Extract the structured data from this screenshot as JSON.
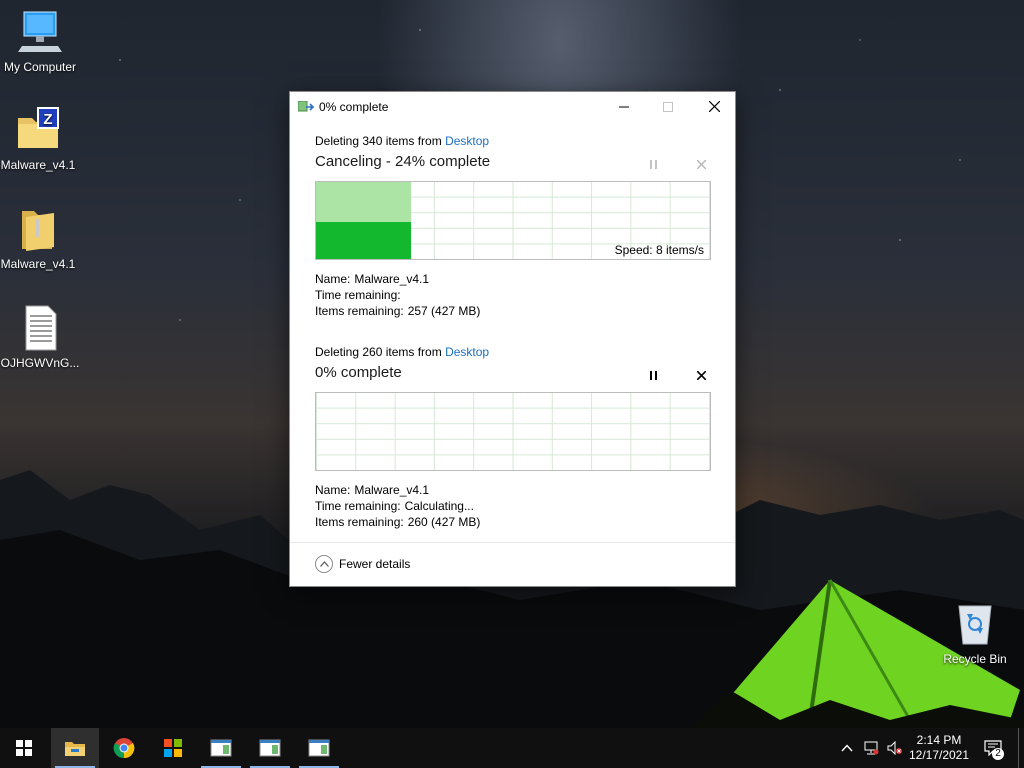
{
  "desktop": {
    "icons": [
      {
        "label": "My Computer",
        "icon": "computer-icon"
      },
      {
        "label": "Malware_v4.1",
        "icon": "zip-folder-icon"
      },
      {
        "label": "Malware_v4.1",
        "icon": "folder-icon"
      },
      {
        "label": "OJHGWVnG...",
        "icon": "text-file-icon"
      },
      {
        "label": "Recycle Bin",
        "icon": "recycle-bin-icon"
      }
    ]
  },
  "dialog": {
    "title": "0% complete",
    "op1": {
      "from_prefix": "Deleting 340 items from",
      "from_link": "Desktop",
      "status": "Canceling - 24% complete",
      "progress_fraction": 0.24,
      "speed": "Speed: 8 items/s",
      "name_label": "Name:",
      "name_value": "Malware_v4.1",
      "time_label": "Time remaining:",
      "time_value": "",
      "items_label": "Items remaining:",
      "items_value": "257 (427 MB)"
    },
    "op2": {
      "from_prefix": "Deleting 260 items from",
      "from_link": "Desktop",
      "status": "0% complete",
      "progress_fraction": 0.0,
      "name_label": "Name:",
      "name_value": "Malware_v4.1",
      "time_label": "Time remaining:",
      "time_value": "Calculating...",
      "items_label": "Items remaining:",
      "items_value": "260 (427 MB)"
    },
    "fewer_details": "Fewer details"
  },
  "taskbar": {
    "time": "2:14 PM",
    "date": "12/17/2021",
    "notification_count": "2",
    "accent": "#8fb7e8"
  },
  "colors": {
    "progress_dark": "#14b82e",
    "progress_light": "#a8e3a0",
    "link": "#1a6fc4"
  }
}
